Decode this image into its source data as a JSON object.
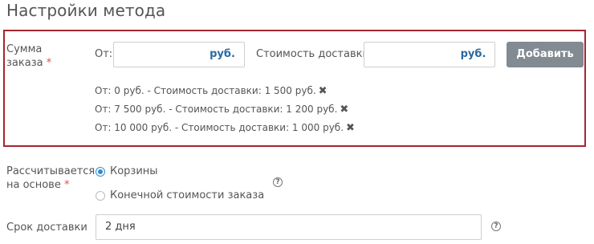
{
  "page": {
    "title": "Настройки метода"
  },
  "order_sum": {
    "label_line1": "Сумма",
    "label_line2": "заказа",
    "required_mark": "*",
    "from_label": "От:",
    "from_value": "",
    "currency": "руб.",
    "delivery_cost_label": "Стоимость доставки:",
    "delivery_cost_value": "",
    "add_button": "Добавить",
    "ranges": [
      {
        "text": "От: 0 руб. - Стоимость доставки: 1 500 руб.",
        "remove": "✖"
      },
      {
        "text": "От: 7 500 руб. - Стоимость доставки: 1 200 руб.",
        "remove": "✖"
      },
      {
        "text": "От: 10 000 руб. - Стоимость доставки: 1 000 руб.",
        "remove": "✖"
      }
    ]
  },
  "calc_basis": {
    "label_line1": "Рассчитывается",
    "label_line2": "на основе",
    "required_mark": "*",
    "options": [
      {
        "label": "Корзины",
        "selected": true
      },
      {
        "label": "Конечной стоимости заказа",
        "selected": false
      }
    ],
    "help": "?"
  },
  "delivery_time": {
    "label": "Срок доставки",
    "value": "2 дня",
    "help": "?"
  },
  "colors": {
    "box_border": "#a32630",
    "accent": "#2a6aa0",
    "button_bg": "#828a92",
    "radio_on": "#2e8ccf",
    "required": "#d9534f"
  }
}
